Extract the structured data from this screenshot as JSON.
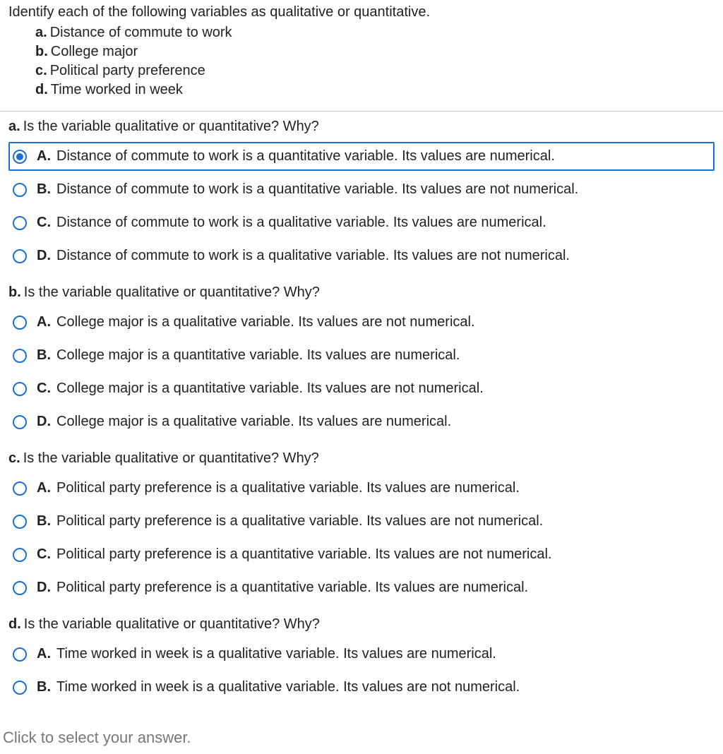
{
  "instruction": "Identify each of the following variables as qualitative or quantitative.",
  "variables": [
    {
      "label": "a.",
      "text": "Distance of commute to work"
    },
    {
      "label": "b.",
      "text": "College major"
    },
    {
      "label": "c.",
      "text": "Political party preference"
    },
    {
      "label": "d.",
      "text": "Time worked in week"
    }
  ],
  "questions": [
    {
      "label": "a.",
      "prompt": "Is the variable qualitative or quantitative? Why?",
      "selected": 0,
      "options": [
        {
          "label": "A.",
          "text": "Distance of commute to work is a quantitative variable. Its values are numerical."
        },
        {
          "label": "B.",
          "text": "Distance of commute to work is a quantitative variable. Its values are not numerical."
        },
        {
          "label": "C.",
          "text": "Distance of commute to work is a qualitative variable. Its values are numerical."
        },
        {
          "label": "D.",
          "text": "Distance of commute to work is a qualitative variable. Its values are not numerical."
        }
      ]
    },
    {
      "label": "b.",
      "prompt": "Is the variable qualitative or quantitative? Why?",
      "selected": -1,
      "options": [
        {
          "label": "A.",
          "text": "College major is a qualitative variable. Its values are not numerical."
        },
        {
          "label": "B.",
          "text": "College major is a quantitative variable. Its values are numerical."
        },
        {
          "label": "C.",
          "text": "College major is a quantitative variable. Its values are not numerical."
        },
        {
          "label": "D.",
          "text": "College major is a qualitative variable. Its values are numerical."
        }
      ]
    },
    {
      "label": "c.",
      "prompt": "Is the variable qualitative or quantitative? Why?",
      "selected": -1,
      "options": [
        {
          "label": "A.",
          "text": "Political party preference is a qualitative variable. Its values are numerical."
        },
        {
          "label": "B.",
          "text": "Political party preference is a qualitative variable. Its values are not numerical."
        },
        {
          "label": "C.",
          "text": "Political party preference is a quantitative variable. Its values are not numerical."
        },
        {
          "label": "D.",
          "text": "Political party preference is a quantitative variable. Its values are numerical."
        }
      ]
    },
    {
      "label": "d.",
      "prompt": "Is the variable qualitative or quantitative? Why?",
      "selected": -1,
      "options": [
        {
          "label": "A.",
          "text": "Time worked in week is a qualitative variable. Its values are numerical."
        },
        {
          "label": "B.",
          "text": "Time worked in week is a qualitative variable. Its values are not numerical."
        }
      ]
    }
  ],
  "footer": "Click to select your answer."
}
